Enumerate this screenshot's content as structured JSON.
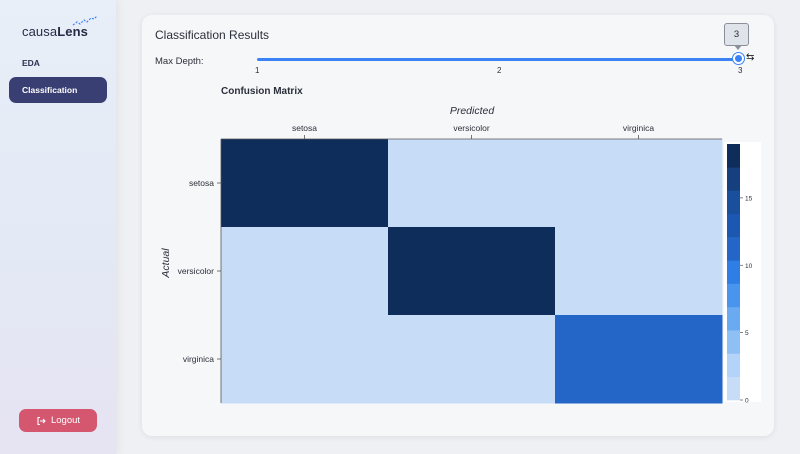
{
  "sidebar": {
    "logo_prefix": "causa",
    "logo_bold": "Lens",
    "items": [
      {
        "label": "EDA",
        "active": false
      },
      {
        "label": "Classification",
        "active": true
      }
    ],
    "logout_label": "Logout"
  },
  "main": {
    "title": "Classification Results",
    "slider": {
      "label": "Max Depth:",
      "min": 1,
      "max": 3,
      "value": 3,
      "ticks": [
        "1",
        "2",
        "3"
      ],
      "tooltip": "3"
    }
  },
  "colors": {
    "accent": "#3b82f6",
    "nav_active": "#3a3f73",
    "logout": "#d4566f"
  },
  "chart_data": {
    "type": "heatmap",
    "title": "Confusion Matrix",
    "xlabel": "Predicted",
    "ylabel": "Actual",
    "x_categories": [
      "setosa",
      "versicolor",
      "virginica"
    ],
    "y_categories": [
      "setosa",
      "versicolor",
      "virginica"
    ],
    "values": [
      [
        19,
        0,
        0
      ],
      [
        0,
        19,
        0
      ],
      [
        0,
        0,
        12
      ]
    ],
    "colorbar": {
      "min": 0,
      "max": 19,
      "ticks": [
        0,
        5,
        10,
        15
      ],
      "colors": [
        "#c6dcf7",
        "#b4d3f8",
        "#8fc0f5",
        "#6aaaf0",
        "#4994ec",
        "#2f7ee6",
        "#2366c8",
        "#1c57b2",
        "#1a4f9e",
        "#163f80",
        "#0f2d5a"
      ]
    }
  }
}
